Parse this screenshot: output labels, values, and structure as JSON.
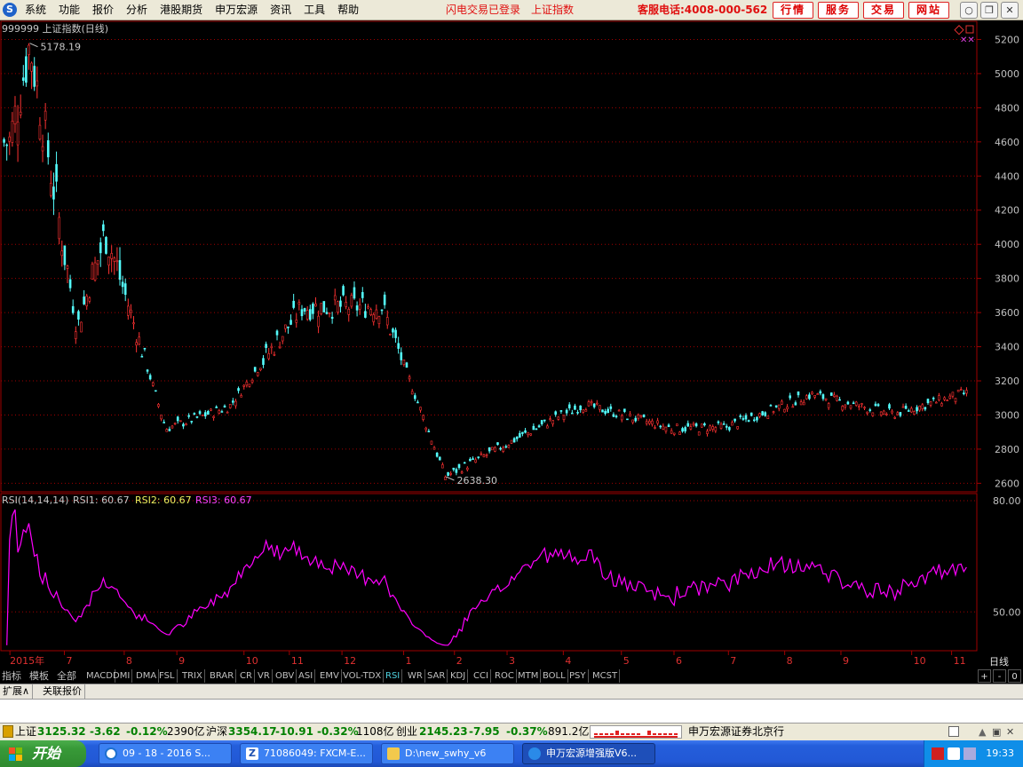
{
  "menubar": {
    "items": [
      "系统",
      "功能",
      "报价",
      "分析",
      "港股期货",
      "申万宏源",
      "资讯",
      "工具",
      "帮助"
    ],
    "flash_status": "闪电交易已登录",
    "index_name": "上证指数",
    "hotline": "客服电话:4008-000-562",
    "buttons": [
      "行情",
      "服务",
      "交易",
      "网站"
    ],
    "window_controls": [
      "minimize-icon",
      "restore-icon",
      "close-icon"
    ]
  },
  "chart_header": {
    "code": "999999",
    "title": "上证指数(日线)"
  },
  "indicator_header": {
    "name": "RSI(14,14,14)",
    "rsi1_label": "RSI1:",
    "rsi1_value": "60.67",
    "rsi2_label": "RSI2:",
    "rsi2_value": "60.67",
    "rsi3_label": "RSI3:",
    "rsi3_value": "60.67"
  },
  "period_label": "日线",
  "colors": {
    "up": "#ff3232",
    "down": "#54fcfc",
    "rsi": "#ff00ff",
    "grid": "#a00000",
    "axis_text": "#c0c0c0"
  },
  "chart_data": {
    "type": "candlestick",
    "title": "999999 上证指数(日线)",
    "ylim": [
      2550,
      5270
    ],
    "y_ticks": [
      2600,
      2800,
      3000,
      3200,
      3400,
      3600,
      3800,
      4000,
      4200,
      4400,
      4600,
      4800,
      5000,
      5200
    ],
    "x_labels": [
      "2015年",
      "7",
      "8",
      "9",
      "10",
      "11",
      "12",
      "1",
      "2",
      "3",
      "4",
      "5",
      "6",
      "7",
      "8",
      "9",
      "10",
      "11"
    ],
    "annotations": [
      {
        "text": "5178.19",
        "type": "max"
      },
      {
        "text": "2638.30",
        "type": "min"
      }
    ],
    "series_shape": [
      {
        "date": "2015-06",
        "close": 4600
      },
      {
        "date": "2015-06-12",
        "close": 5178
      },
      {
        "date": "2015-07-08",
        "close": 3510
      },
      {
        "date": "2015-07-24",
        "close": 4070
      },
      {
        "date": "2015-08-26",
        "close": 2920
      },
      {
        "date": "2015-09-30",
        "close": 3050
      },
      {
        "date": "2015-11-09",
        "close": 3630
      },
      {
        "date": "2015-12-23",
        "close": 3640
      },
      {
        "date": "2016-01-27",
        "close": 2640
      },
      {
        "date": "2016-03-31",
        "close": 3000
      },
      {
        "date": "2016-04-13",
        "close": 3060
      },
      {
        "date": "2016-05-31",
        "close": 2920
      },
      {
        "date": "2016-06-30",
        "close": 2930
      },
      {
        "date": "2016-08-16",
        "close": 3120
      },
      {
        "date": "2016-09-30",
        "close": 3005
      },
      {
        "date": "2016-11-07",
        "close": 3125
      }
    ],
    "indicator": {
      "type": "line",
      "name": "RSI(14,14,14)",
      "ylim": [
        40,
        80
      ],
      "y_ticks": [
        50.0,
        80.0
      ],
      "last_value": 60.67
    }
  },
  "tabs": {
    "left_labels": [
      "指标",
      "模板",
      "全部"
    ],
    "indicator_tabs": [
      "MACD",
      "DMI",
      "DMA",
      "FSL",
      "TRIX",
      "BRAR",
      "CR",
      "VR",
      "OBV",
      "ASI",
      "EMV",
      "VOL-TDX",
      "RSI",
      "WR",
      "SAR",
      "KDJ",
      "CCI",
      "ROC",
      "MTM",
      "BOLL",
      "PSY",
      "MCST"
    ],
    "active": "RSI",
    "controls": [
      "+",
      "-",
      "0"
    ]
  },
  "expand_tabs": [
    "扩展∧",
    "关联报价"
  ],
  "statusbar": {
    "sh_name": "上证",
    "sh_price": "3125.32",
    "sh_change": "-3.62",
    "sh_pct": "-0.12%",
    "sh_amount": "2390亿",
    "hs_name": "沪深",
    "hs_price": "3354.17",
    "hs_change": "-10.91",
    "hs_pct": "-0.32%",
    "hs_amount": "1108亿",
    "cy_name": "创业",
    "cy_price": "2145.23",
    "cy_change": "-7.95",
    "cy_pct": "-0.37%",
    "cy_amount": "891.2亿",
    "broker": "申万宏源证券北京行"
  },
  "taskbar": {
    "start_label": "开始",
    "tasks": [
      "09 - 18 - 2016 S...",
      "71086049: FXCM-E...",
      "D:\\new_swhy_v6",
      "申万宏源增强版V6..."
    ],
    "clock": "19:33"
  }
}
